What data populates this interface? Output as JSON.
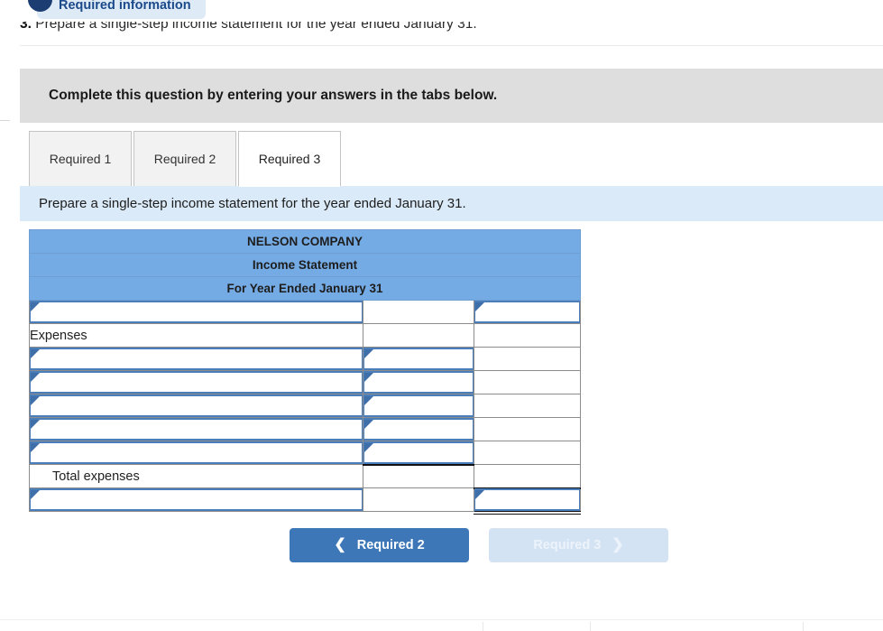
{
  "banner": {
    "pill_label": "Required information",
    "dot_icon": "status-circle-icon"
  },
  "question": {
    "number": "3.",
    "text": "Prepare a single-step income statement for the year ended January 31."
  },
  "instruction_band": {
    "text": "Complete this question by entering your answers in the tabs below."
  },
  "tabs": [
    {
      "label": "Required 1",
      "active": false
    },
    {
      "label": "Required 2",
      "active": false
    },
    {
      "label": "Required 3",
      "active": true
    }
  ],
  "tab_instruction": {
    "text": "Prepare a single-step income statement for the year ended January 31."
  },
  "statement": {
    "header_rows": [
      "NELSON COMPANY",
      "Income Statement",
      "For Year Ended January 31"
    ],
    "rows": [
      {
        "kind": "input",
        "label": "",
        "col1": "input",
        "col2": "blank",
        "col3": "input"
      },
      {
        "kind": "label",
        "label": "Expenses",
        "indent": false,
        "col2": "blank",
        "col3": "blank"
      },
      {
        "kind": "input",
        "label": "",
        "col1": "input",
        "col2": "input",
        "col3": "blank"
      },
      {
        "kind": "input",
        "label": "",
        "col1": "input",
        "col2": "input",
        "col3": "blank"
      },
      {
        "kind": "input",
        "label": "",
        "col1": "input",
        "col2": "input",
        "col3": "blank"
      },
      {
        "kind": "input",
        "label": "",
        "col1": "input",
        "col2": "input",
        "col3": "blank"
      },
      {
        "kind": "input",
        "label": "",
        "col1": "input",
        "col2": "input",
        "col3": "blank"
      },
      {
        "kind": "label",
        "label": "Total expenses",
        "indent": true,
        "col2": "blank-topline",
        "col3": "blank"
      },
      {
        "kind": "input",
        "label": "",
        "col1": "input",
        "col2": "blank",
        "col3": "input-total"
      }
    ],
    "field_marker_icon": "cell-corner-marker-icon"
  },
  "nav": {
    "prev_label": "Required 2",
    "prev_icon": "chevron-left-icon",
    "next_label": "Required 3",
    "next_icon": "chevron-right-icon"
  },
  "colors": {
    "header_blue": "#75abe4",
    "strip_blue": "#daeaf8",
    "band_grey": "#dedede",
    "pill_blue": "#dfeaf7",
    "dot_navy": "#1c3d72",
    "button_blue": "#3d77b8",
    "button_disabled": "#d4e3f3",
    "field_border": "#4a7ebb"
  }
}
